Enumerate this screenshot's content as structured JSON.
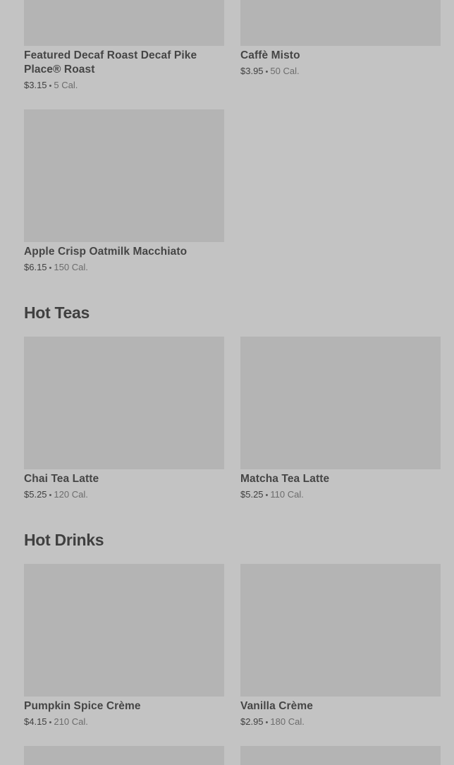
{
  "sections": {
    "hot_teas": {
      "title": "Hot Teas"
    },
    "hot_drinks": {
      "title": "Hot Drinks"
    }
  },
  "items": {
    "decaf_pike": {
      "name": "Featured Decaf Roast Decaf Pike Place® Roast",
      "price": "$3.15",
      "cal": "5 Cal."
    },
    "caffe_misto": {
      "name": "Caffè Misto",
      "price": "$3.95",
      "cal": "50 Cal."
    },
    "apple_crisp": {
      "name": "Apple Crisp Oatmilk Macchiato",
      "price": "$6.15",
      "cal": "150 Cal."
    },
    "chai_latte": {
      "name": "Chai Tea Latte",
      "price": "$5.25",
      "cal": "120 Cal."
    },
    "matcha_latte": {
      "name": "Matcha Tea Latte",
      "price": "$5.25",
      "cal": "110 Cal."
    },
    "pumpkin_creme": {
      "name": "Pumpkin Spice Crème",
      "price": "$4.15",
      "cal": "210 Cal."
    },
    "vanilla_creme": {
      "name": "Vanilla Crème",
      "price": "$2.95",
      "cal": "180 Cal."
    }
  },
  "separator": "•"
}
